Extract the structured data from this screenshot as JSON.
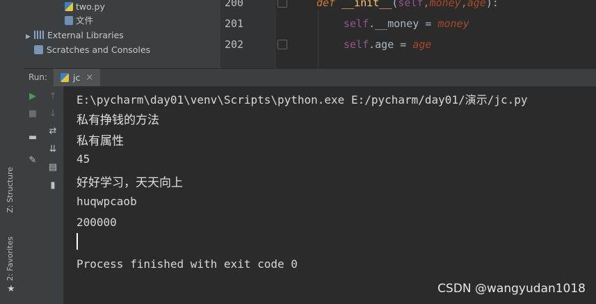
{
  "project_tree": {
    "items": [
      {
        "label": "two.py",
        "icon": "python-file-icon"
      },
      {
        "label": "文件",
        "icon": "file-icon"
      },
      {
        "label": "External Libraries",
        "icon": "library-icon"
      },
      {
        "label": "Scratches and Consoles",
        "icon": "scratches-icon"
      }
    ]
  },
  "editor": {
    "line_numbers": [
      "200",
      "201",
      "202"
    ]
  },
  "run_panel": {
    "label": "Run:",
    "tab_label": "jc"
  },
  "side_tabs": {
    "structure": "Z: Structure",
    "structure_num": "7",
    "favorites": "2: Favorites"
  },
  "console": {
    "lines": [
      "E:\\pycharm\\day01\\venv\\Scripts\\python.exe E:/pycharm/day01/演示/jc.py",
      "私有挣钱的方法",
      "私有属性",
      "45",
      "好好学习，天天向上",
      "huqwpcaob",
      "200000",
      "Process finished with exit code 0"
    ]
  },
  "watermark": "CSDN @wangyudan1018",
  "colors": {
    "keyword": "#cc7832",
    "function": "#ffc66d",
    "self": "#94558d",
    "param": "#aa4926",
    "run_green": "#499c54"
  }
}
